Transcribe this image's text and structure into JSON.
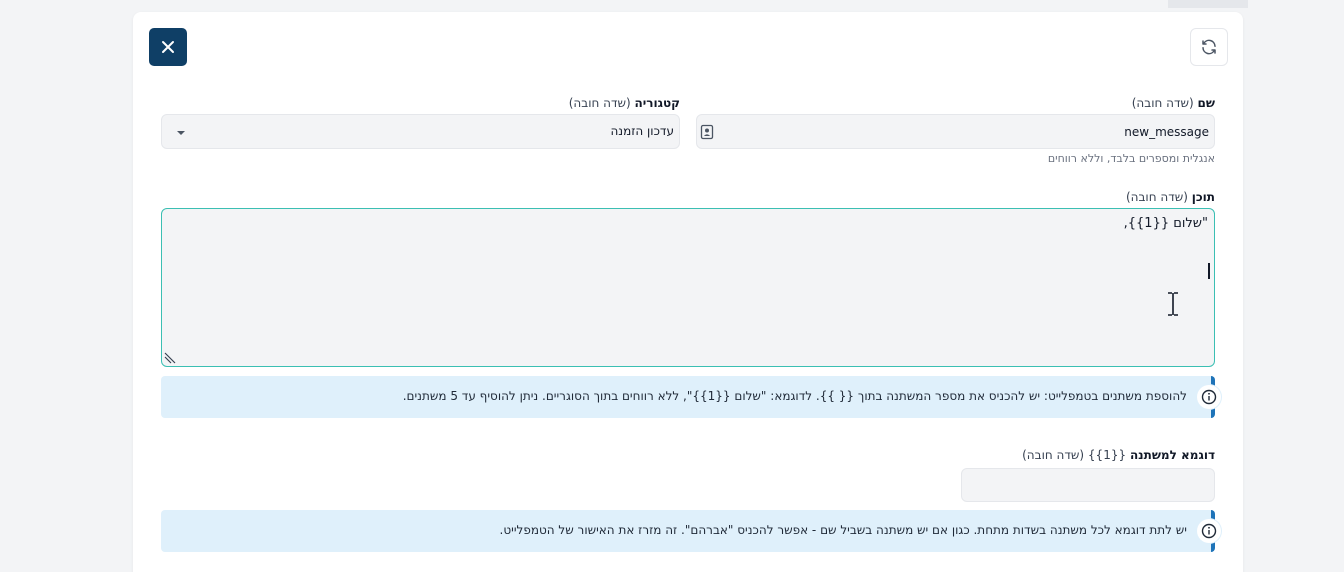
{
  "top_strip": {
    "text": ""
  },
  "icons": {
    "close": "close-icon",
    "refresh": "refresh-icon",
    "dropdown": "caret-down-icon",
    "contact_card": "contact-card-icon",
    "info": "info-icon"
  },
  "colors": {
    "primary": "#0f3f66",
    "focus_border": "#3bbfb3",
    "info_bg": "#dff0fb",
    "info_bar": "#1e73b8"
  },
  "form": {
    "name": {
      "label": "שם",
      "required": "(שדה חובה)",
      "value": "new_message",
      "hint": "אנגלית ומספרים בלבד, וללא רווחים"
    },
    "category": {
      "label": "קטגוריה",
      "required": "(שדה חובה)",
      "selected": "עדכון הזמנה"
    },
    "content": {
      "label": "תוכן",
      "required": "(שדה חובה)",
      "value": "\"שלום {{1}},"
    },
    "variables_info": "להוספת משתנים בטמפלייט: יש להכניס את מספר המשתנה בתוך {{ }}. לדוגמא: \"שלום {{1}}\", ללא רווחים בתוך הסוגריים. ניתן להוסיף עד 5 משתנים.",
    "example_variable": {
      "label": "דוגמא למשתנה",
      "var_ref": "{{1}}",
      "required": "(שדה חובה)",
      "value": ""
    },
    "example_info": "יש לתת דוגמא לכל משתנה בשדות מתחת. כגון אם יש משתנה בשביל שם - אפשר להכניס \"אברהם\". זה מזרז את האישור של הטמפלייט."
  }
}
